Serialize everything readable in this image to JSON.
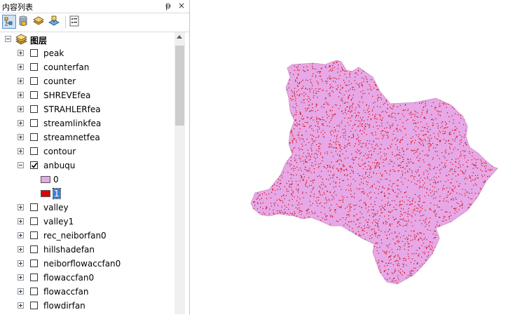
{
  "window": {
    "title": "内容列表"
  },
  "toc_controls": {
    "pin_icon": "pin-icon",
    "close_icon": "close-icon",
    "pin_glyph": "ᵽ",
    "close_glyph": "×"
  },
  "toolbar": {
    "buttons": [
      {
        "name": "list-by-drawing-order-button",
        "icon": "drawing-order-icon",
        "active": true
      },
      {
        "name": "list-by-source-button",
        "icon": "database-icon",
        "active": false
      },
      {
        "name": "list-by-visibility-button",
        "icon": "layers-visibility-icon",
        "active": false
      },
      {
        "name": "list-by-selection-button",
        "icon": "selection-icon",
        "active": false
      },
      {
        "name": "options-button",
        "icon": "options-list-icon",
        "active": false
      }
    ]
  },
  "tree": {
    "root": {
      "label": "图层",
      "icon": "layers-icon",
      "expanded": true
    },
    "layers": [
      {
        "name": "peak",
        "checked": false,
        "expanded": false
      },
      {
        "name": "counterfan",
        "checked": false,
        "expanded": false
      },
      {
        "name": "counter",
        "checked": false,
        "expanded": false
      },
      {
        "name": "SHREVEfea",
        "checked": false,
        "expanded": false
      },
      {
        "name": "STRAHLERfea",
        "checked": false,
        "expanded": false
      },
      {
        "name": "streamlinkfea",
        "checked": false,
        "expanded": false
      },
      {
        "name": "streamnetfea",
        "checked": false,
        "expanded": false
      },
      {
        "name": "contour",
        "checked": false,
        "expanded": false
      },
      {
        "name": "anbuqu",
        "checked": true,
        "expanded": true
      },
      {
        "name": "valley",
        "checked": false,
        "expanded": false
      },
      {
        "name": "valley1",
        "checked": false,
        "expanded": false
      },
      {
        "name": "rec_neiborfan0",
        "checked": false,
        "expanded": false
      },
      {
        "name": "hillshadefan",
        "checked": false,
        "expanded": false
      },
      {
        "name": "neiborflowaccfan0",
        "checked": false,
        "expanded": false
      },
      {
        "name": "flowaccfan0",
        "checked": false,
        "expanded": false
      },
      {
        "name": "flowaccfan",
        "checked": false,
        "expanded": false
      },
      {
        "name": "flowdirfan",
        "checked": false,
        "expanded": false
      }
    ],
    "legend": [
      {
        "value": "0",
        "color": "#e6a8e6"
      },
      {
        "value": "1",
        "color": "#e00000",
        "selected": true
      }
    ]
  },
  "map": {
    "fill_color": "#e6a8e6",
    "dot_color": "#d40000"
  }
}
